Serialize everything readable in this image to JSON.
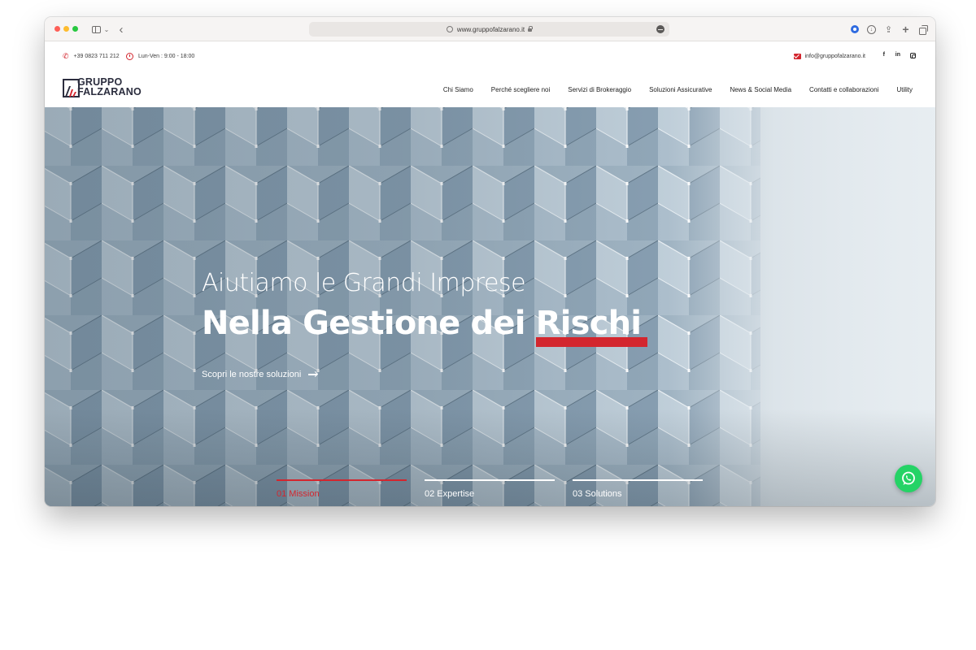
{
  "browser": {
    "url": "www.gruppofalzarano.it"
  },
  "topbar": {
    "phone": "+39 0823 711 212",
    "hours": "Lun-Ven : 9:00 - 18:00",
    "email": "info@gruppofalzarano.it",
    "social": [
      "f",
      "in"
    ]
  },
  "logo": {
    "line1": "GRUPPO",
    "line2": "FALZARANO"
  },
  "nav": {
    "items": [
      {
        "label": "Chi Siamo"
      },
      {
        "label": "Perché scegliere noi"
      },
      {
        "label": "Servizi di Brokeraggio"
      },
      {
        "label": "Soluzioni Assicurative"
      },
      {
        "label": "News & Social Media"
      },
      {
        "label": "Contatti e collaborazioni"
      },
      {
        "label": "Utility"
      }
    ]
  },
  "hero": {
    "subtitle": "Aiutiamo le Grandi Imprese",
    "title_prefix": "Nella Gestione dei ",
    "title_highlight": "Rischi",
    "cta": "Scopri le nostre soluzioni",
    "slides": [
      {
        "label": "01 Mission",
        "active": true
      },
      {
        "label": "02 Expertise",
        "active": false
      },
      {
        "label": "03 Solutions",
        "active": false
      }
    ]
  },
  "colors": {
    "accent": "#d3262e",
    "navy": "#2b2d3e",
    "whatsapp": "#25d366"
  }
}
